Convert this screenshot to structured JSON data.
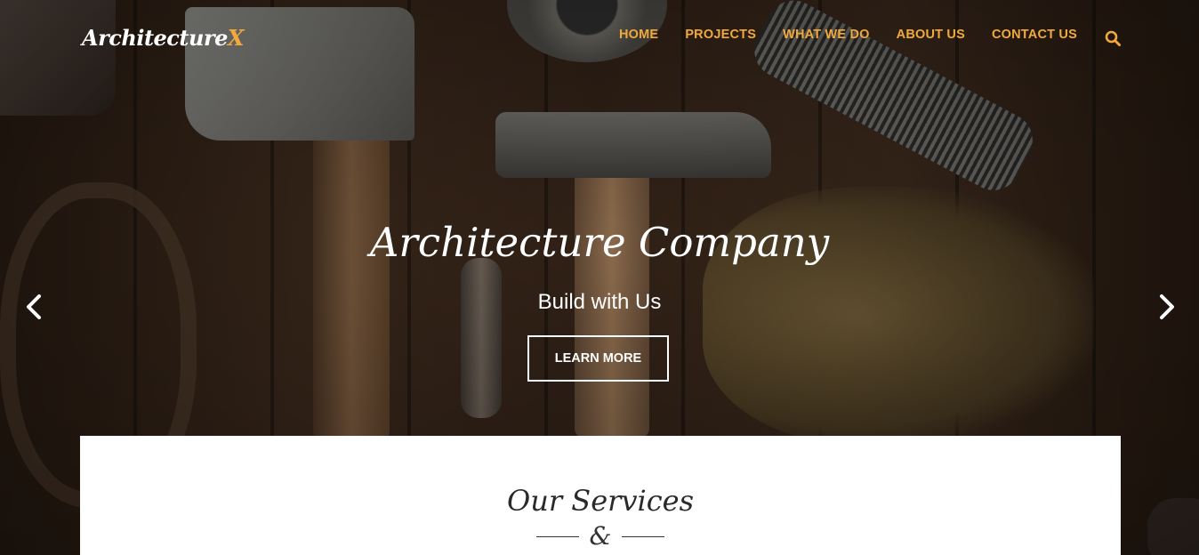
{
  "header": {
    "logo_text": "Architecture",
    "logo_accent": "X",
    "nav": [
      {
        "label": "HOME"
      },
      {
        "label": "PROJECTS"
      },
      {
        "label": "WHAT WE DO"
      },
      {
        "label": "ABOUT US"
      },
      {
        "label": "CONTACT US"
      }
    ],
    "search_icon": "search-icon"
  },
  "hero": {
    "title": "Architecture Company",
    "subtitle": "Build with Us",
    "button_label": "LEARN MORE",
    "prev_icon": "chevron-left-icon",
    "next_icon": "chevron-right-icon"
  },
  "services": {
    "title": "Our Services",
    "divider_symbol": "&"
  },
  "colors": {
    "accent": "#f2a93b",
    "text_light": "#ffffff",
    "panel_bg": "#ffffff"
  }
}
